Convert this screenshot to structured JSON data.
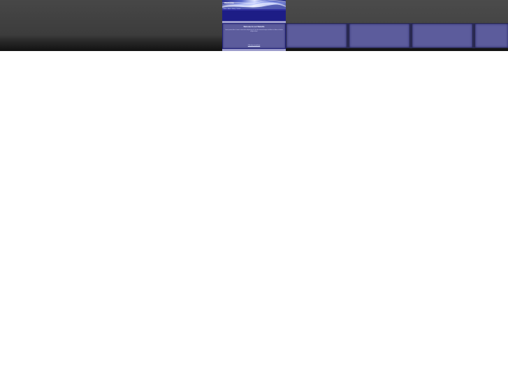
{
  "site": {
    "banner_title": "Welcome",
    "nav_text": "Home · About · Gallery · Contact"
  },
  "welcome": {
    "heading": "Welcome to our Website",
    "body": "Lorem ipsum dolor sit amet, consectetur adipiscing elit. Sed do eiusmod tempor incididunt ut labore et dolore magna aliqua.",
    "link": "Click here to continue"
  },
  "cards": [
    {
      "id": "card-1"
    },
    {
      "id": "card-2"
    },
    {
      "id": "card-3"
    },
    {
      "id": "card-4"
    }
  ],
  "colors": {
    "page_bg": "#ffffff",
    "strip_dark": "#2e2e2e",
    "column_navy": "#23237c",
    "card_fill": "#5c5c9c",
    "divider": "#9c9ccb"
  }
}
